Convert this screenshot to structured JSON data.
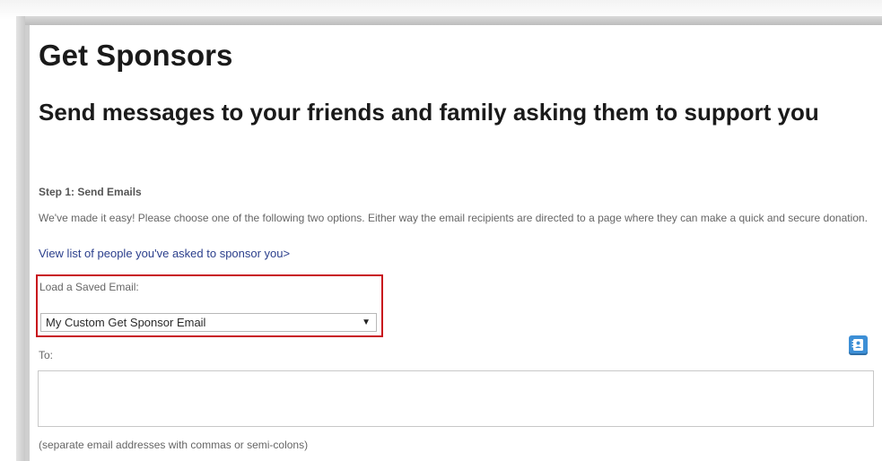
{
  "page": {
    "title": "Get Sponsors",
    "subtitle": "Send messages to your friends and family asking them to support you"
  },
  "step": {
    "label": "Step 1: Send Emails",
    "intro": "We've made it easy! Please choose one of the following two options. Either way the email recipients are directed to a page where they can make a quick and secure donation.",
    "view_link": "View list of people you've asked to sponsor you>"
  },
  "saved_email": {
    "label": "Load a Saved Email:",
    "selected": "My Custom Get Sponsor Email",
    "highlight_color": "#c8101c"
  },
  "to": {
    "label": "To:",
    "value": "",
    "hint": "(separate email addresses with commas or semi-colons)"
  },
  "icons": {
    "contacts": "address-book-icon",
    "dropdown": "caret-down-icon"
  },
  "colors": {
    "link": "#2b3f8c",
    "icon_button": "#3d8fd6"
  }
}
